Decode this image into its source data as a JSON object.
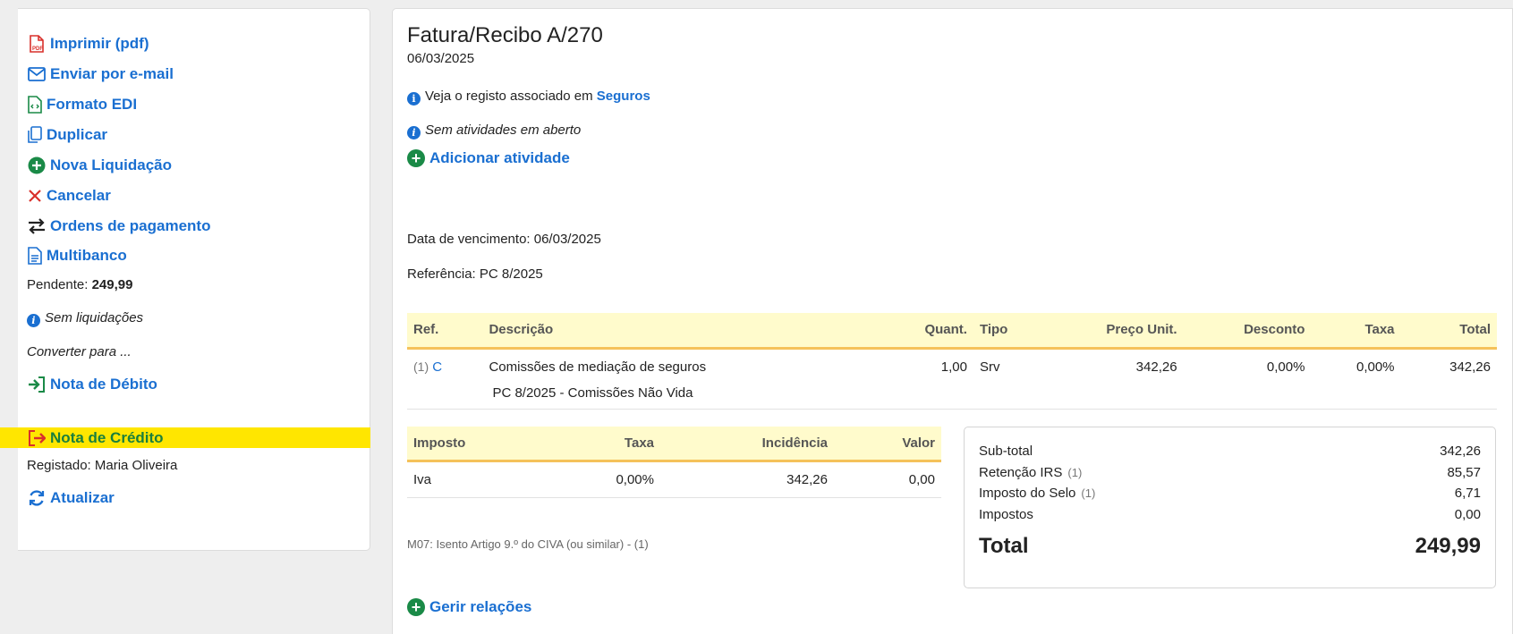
{
  "sidebar": {
    "actions": [
      {
        "label": "Imprimir (pdf)",
        "icon": "pdf-icon"
      },
      {
        "label": "Enviar por e-mail",
        "icon": "envelope-icon"
      },
      {
        "label": "Formato EDI",
        "icon": "code-file-icon"
      },
      {
        "label": "Duplicar",
        "icon": "copy-icon"
      },
      {
        "label": "Nova Liquidação",
        "icon": "plus-circle-icon"
      },
      {
        "label": "Cancelar",
        "icon": "close-icon"
      },
      {
        "label": "Ordens de pagamento",
        "icon": "swap-arrows-icon"
      },
      {
        "label": "Multibanco",
        "icon": "document-icon"
      }
    ],
    "pending_label": "Pendente:",
    "pending_value": "249,99",
    "no_settlements": "Sem liquidações",
    "convert_label": "Converter para ...",
    "debit_note": "Nota de Débito",
    "credit_note": "Nota de Crédito",
    "registered": "Registado: Maria Oliveira",
    "refresh": "Atualizar"
  },
  "document": {
    "title": "Fatura/Recibo A/270",
    "date": "06/03/2025",
    "linked_text": "Veja o registo associado em",
    "linked_link": "Seguros",
    "no_activities": "Sem atividades em aberto",
    "add_activity": "Adicionar atividade",
    "due_date": "Data de vencimento: 06/03/2025",
    "reference": "Referência: PC 8/2025",
    "manage_relations": "Gerir relações"
  },
  "lines_table": {
    "headers": [
      "Ref.",
      "Descrição",
      "Quant.",
      "Tipo",
      "Preço Unit.",
      "Desconto",
      "Taxa",
      "Total"
    ],
    "rows": [
      {
        "num": "(1)",
        "ref": "C",
        "description": "Comissões de mediação de seguros",
        "quantity": "1,00",
        "type": "Srv",
        "unit_price": "342,26",
        "discount": "0,00%",
        "rate": "0,00%",
        "total": "342,26",
        "detail": "PC 8/2025 - Comissões Não Vida"
      }
    ]
  },
  "taxes_table": {
    "headers": [
      "Imposto",
      "Taxa",
      "Incidência",
      "Valor"
    ],
    "rows": [
      {
        "tax": "Iva",
        "rate": "0,00%",
        "base": "342,26",
        "value": "0,00"
      }
    ],
    "footnote": "M07: Isento Artigo 9.º do CIVA (ou similar) - (1)"
  },
  "totals": {
    "rows": [
      {
        "label": "Sub-total",
        "note": "",
        "value": "342,26"
      },
      {
        "label": "Retenção IRS",
        "note": "(1)",
        "value": "85,57"
      },
      {
        "label": "Imposto do Selo",
        "note": "(1)",
        "value": "6,71"
      },
      {
        "label": "Impostos",
        "note": "",
        "value": "0,00"
      }
    ],
    "total_label": "Total",
    "total_value": "249,99"
  },
  "colors": {
    "link": "#1a6fd1",
    "green": "#1a8a47",
    "highlight": "#ffe600",
    "table_header": "#fffbcc",
    "table_border": "#f5c25a"
  }
}
